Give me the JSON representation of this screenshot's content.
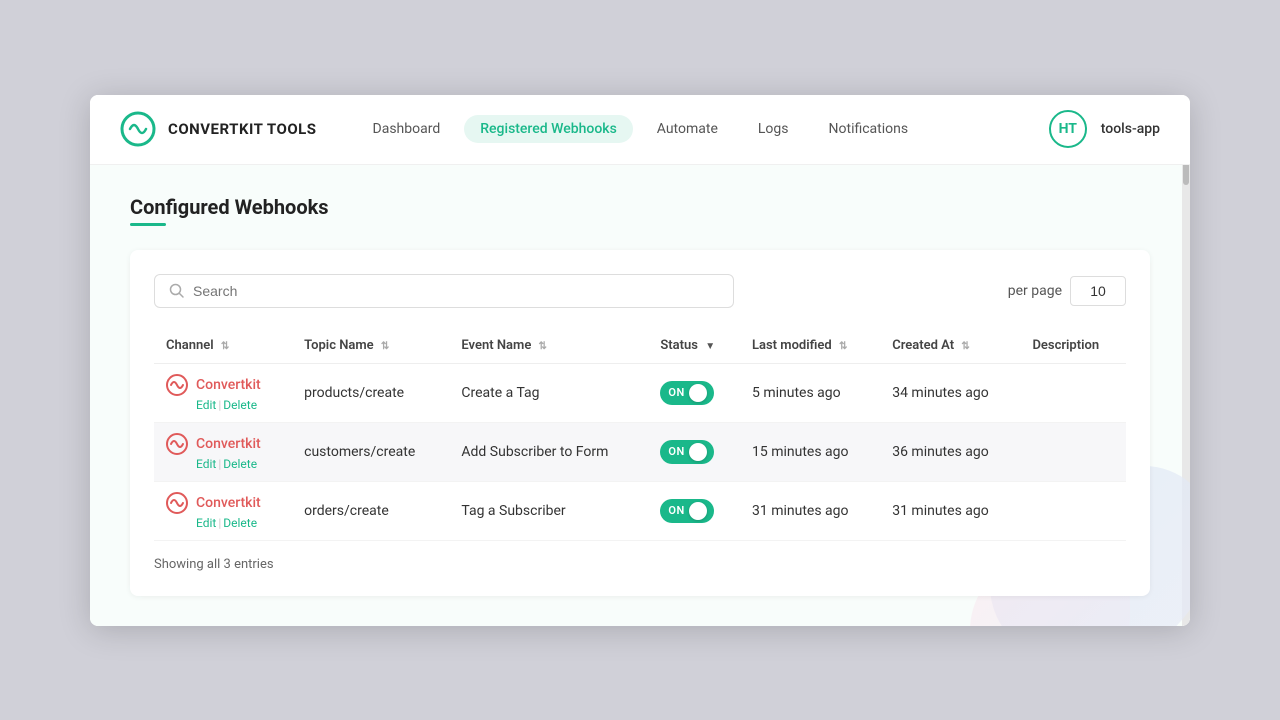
{
  "app": {
    "logo_text": "CONVERTKIT TOOLS",
    "user_initials": "HT",
    "app_name": "tools-app"
  },
  "nav": {
    "links": [
      {
        "id": "dashboard",
        "label": "Dashboard",
        "active": false
      },
      {
        "id": "registered-webhooks",
        "label": "Registered Webhooks",
        "active": true
      },
      {
        "id": "automate",
        "label": "Automate",
        "active": false
      },
      {
        "id": "logs",
        "label": "Logs",
        "active": false
      },
      {
        "id": "notifications",
        "label": "Notifications",
        "active": false
      }
    ]
  },
  "page": {
    "title": "Configured Webhooks"
  },
  "search": {
    "placeholder": "Search",
    "value": ""
  },
  "pagination": {
    "per_page_label": "per page",
    "per_page_value": "10"
  },
  "table": {
    "columns": [
      {
        "id": "channel",
        "label": "Channel",
        "sortable": true,
        "sort_active": false
      },
      {
        "id": "topic_name",
        "label": "Topic Name",
        "sortable": true,
        "sort_active": false
      },
      {
        "id": "event_name",
        "label": "Event Name",
        "sortable": true,
        "sort_active": false
      },
      {
        "id": "status",
        "label": "Status",
        "sortable": true,
        "sort_active": true
      },
      {
        "id": "last_modified",
        "label": "Last modified",
        "sortable": true,
        "sort_active": false
      },
      {
        "id": "created_at",
        "label": "Created At",
        "sortable": true,
        "sort_active": false
      },
      {
        "id": "description",
        "label": "Description",
        "sortable": false,
        "sort_active": false
      }
    ],
    "rows": [
      {
        "channel_name": "Convertkit",
        "edit_label": "Edit",
        "delete_label": "Delete",
        "topic_name": "products/create",
        "event_name": "Create a Tag",
        "status": "ON",
        "last_modified": "5 minutes ago",
        "created_at": "34 minutes ago",
        "description": ""
      },
      {
        "channel_name": "Convertkit",
        "edit_label": "Edit",
        "delete_label": "Delete",
        "topic_name": "customers/create",
        "event_name": "Add Subscriber to Form",
        "status": "ON",
        "last_modified": "15 minutes ago",
        "created_at": "36 minutes ago",
        "description": ""
      },
      {
        "channel_name": "Convertkit",
        "edit_label": "Edit",
        "delete_label": "Delete",
        "topic_name": "orders/create",
        "event_name": "Tag a Subscriber",
        "status": "ON",
        "last_modified": "31 minutes ago",
        "created_at": "31 minutes ago",
        "description": ""
      }
    ]
  },
  "footer": {
    "showing_text": "Showing all 3 entries"
  }
}
